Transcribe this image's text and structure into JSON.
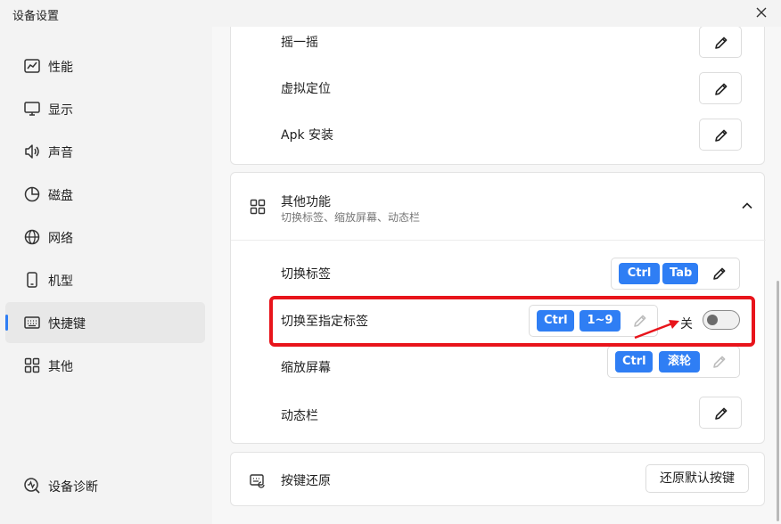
{
  "window": {
    "title": "设备设置"
  },
  "sidebar": {
    "items": [
      {
        "label": "性能",
        "icon": "performance-icon"
      },
      {
        "label": "显示",
        "icon": "monitor-icon"
      },
      {
        "label": "声音",
        "icon": "speaker-icon"
      },
      {
        "label": "磁盘",
        "icon": "pie-chart-icon"
      },
      {
        "label": "网络",
        "icon": "globe-icon"
      },
      {
        "label": "机型",
        "icon": "phone-icon"
      },
      {
        "label": "快捷键",
        "icon": "keyboard-icon",
        "active": true
      },
      {
        "label": "其他",
        "icon": "grid-icon"
      }
    ],
    "diagnostics": {
      "label": "设备诊断",
      "icon": "diagnostics-icon"
    }
  },
  "shortcuts_top": [
    {
      "label": "摇一摇"
    },
    {
      "label": "虚拟定位"
    },
    {
      "label": "Apk 安装"
    }
  ],
  "other_functions": {
    "title": "其他功能",
    "subtitle": "切换标签、缩放屏幕、动态栏",
    "rows": [
      {
        "label": "切换标签",
        "keys": [
          "Ctrl",
          "Tab"
        ],
        "editable": true
      },
      {
        "label": "切换至指定标签",
        "keys": [
          "Ctrl",
          "1~9"
        ],
        "editable": false,
        "toggle_label": "关",
        "toggle_on": false
      },
      {
        "label": "缩放屏幕",
        "keys": [
          "Ctrl",
          "滚轮"
        ],
        "editable": false
      },
      {
        "label": "动态栏",
        "keys": [],
        "editable": true
      }
    ]
  },
  "restore": {
    "label": "按键还原",
    "button": "还原默认按键"
  },
  "colors": {
    "accent": "#2f7ef4",
    "highlight": "#e8141b",
    "active_nav": "#e8e8e8"
  }
}
